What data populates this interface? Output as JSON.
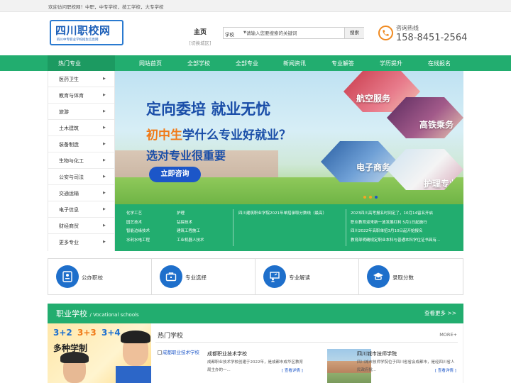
{
  "topbar": {
    "welcome": "欢迎访问职校网！中职，中专学校，技工学校，大专学校"
  },
  "logo": {
    "title": "四川职校网",
    "subtitle": "四川中专职业学校招生信息网"
  },
  "home": {
    "title": "主页",
    "switch": "[切换城区]"
  },
  "search": {
    "select": "学校",
    "placeholder": "请输入您要搜索的关键词",
    "button": "搜索"
  },
  "hotline": {
    "label": "咨询热线",
    "number": "158-8451-2564",
    "accent": "#f08a20"
  },
  "nav": {
    "hot": "热门专业",
    "items": [
      "网站首页",
      "全部学校",
      "全部专业",
      "新闻资讯",
      "专业解答",
      "学历提升",
      "在线报名"
    ],
    "bg": "#22ad6f"
  },
  "sidebar": {
    "items": [
      {
        "label": "医药卫生"
      },
      {
        "label": "教育与体育"
      },
      {
        "label": "旅游"
      },
      {
        "label": "土木建筑"
      },
      {
        "label": "装备制造"
      },
      {
        "label": "生物与化工"
      },
      {
        "label": "公安与司法"
      },
      {
        "label": "交通运输"
      },
      {
        "label": "电子信息"
      },
      {
        "label": "财经商贸"
      },
      {
        "label": "更多专业"
      }
    ]
  },
  "banner": {
    "line1": "定向委培 就业无忧",
    "line2a": "初中生",
    "line2b": "学什么专业好就业？",
    "line3": "选对专业很重要",
    "cta": "立即咨询",
    "hexes": [
      "航空服务",
      "高铁乘务",
      "电子商务",
      "护理专业"
    ]
  },
  "strip": {
    "col1": [
      "化学工艺",
      "园艺技术",
      "智能边缘技术",
      "水利水电工程"
    ],
    "col2": [
      "护理",
      "钻探技术",
      "建筑工程施工",
      "工业机器人技术"
    ],
    "news1": [
      "四川建筑职业学院2021年单招录取分数线（最高）"
    ],
    "news2": [
      "2023四川高考报名时间定了，10月14留名开启",
      "职业教育迎来新一波发展红利 5月1日起施行",
      "四川2022年高职单招3月10日起开始报名",
      "教育部明确规定职业本科与普通本科学位证书具有..."
    ]
  },
  "categories": [
    {
      "label": "公办职校",
      "icon": "id-card-icon"
    },
    {
      "label": "专业选择",
      "icon": "briefcase-icon"
    },
    {
      "label": "专业解读",
      "icon": "presentation-icon"
    },
    {
      "label": "录取分数",
      "icon": "graduation-cap-icon"
    }
  ],
  "schools": {
    "title": "职业学校",
    "subtitle": "/ Vocational schools",
    "more": "查看更多 >>",
    "hot_title": "热门学校",
    "hot_more": "MORE+"
  },
  "promo": {
    "n1": "3+2",
    "n2": "3+3",
    "n3": "3+4",
    "desc": "多种学制"
  },
  "school_items": [
    {
      "img_alt": "成都职业技术学校",
      "name": "成都职业技术学校",
      "desc": "成都职业技术学校创建于2022年，是成都市成华区教育局主办的一...",
      "link": "[ 查看详情 ]"
    },
    {
      "name": "四川城市技师学院",
      "desc": "四川城市技师学院位于四川省省会成都市，是经四川省人民政府批...",
      "link": "[ 查看详情 ]"
    }
  ]
}
